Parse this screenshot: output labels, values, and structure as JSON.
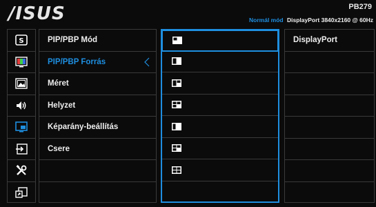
{
  "header": {
    "logo": "/ISUS",
    "model": "PB279",
    "mode": "Normál mód",
    "signal": "DisplayPort  3840x2160 @ 60Hz"
  },
  "sidebar": {
    "icons": [
      "splendid-icon",
      "color-icon",
      "image-icon",
      "sound-icon",
      "pip-pbp-icon",
      "input-select-icon",
      "system-setup-icon",
      "shortcut-icon"
    ]
  },
  "menu": {
    "items": [
      {
        "label": "PIP/PBP Mód"
      },
      {
        "label": "PIP/PBP Forrás"
      },
      {
        "label": "Méret"
      },
      {
        "label": "Helyzet"
      },
      {
        "label": "Képarány-beállítás"
      },
      {
        "label": "Csere"
      },
      {
        "label": ""
      },
      {
        "label": ""
      }
    ]
  },
  "layouts": {
    "items": [
      "layout-2-top-left-icon",
      "layout-2-left-icon",
      "layout-3-icon",
      "layout-4-icon",
      "layout-2-vertical-icon",
      "layout-3-alt-icon",
      "layout-4-alt-icon",
      ""
    ]
  },
  "sources": {
    "items": [
      "DisplayPort",
      "",
      "",
      "",
      "",
      "",
      "",
      ""
    ]
  },
  "colors": {
    "accent": "#1e8fe0",
    "background": "#0b0b0c",
    "grid": "#3a3a3a"
  }
}
